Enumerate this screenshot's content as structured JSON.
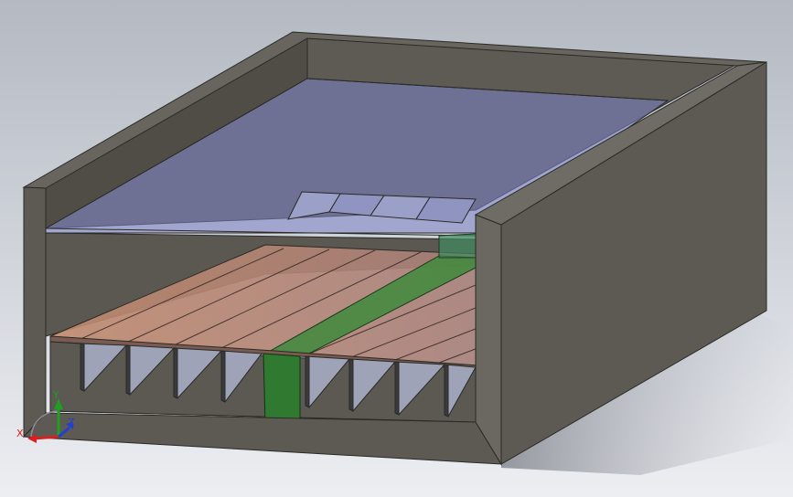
{
  "viewport": {
    "background_top": "#b9bec6",
    "background_bottom": "#e8eaee"
  },
  "model": {
    "frame_color": "#5c5a52",
    "frame_edge_color": "#2a2a26",
    "glass_color": "#7e84c8",
    "plate_color": "#b8867a",
    "highlight_color": "#3a7a3c",
    "fin_color": "#9ea3b8"
  },
  "triad": {
    "x_label": "X",
    "y_label": "Y",
    "z_label": "Z",
    "x_color": "#d82020",
    "y_color": "#20a020",
    "z_color": "#2040d0"
  }
}
